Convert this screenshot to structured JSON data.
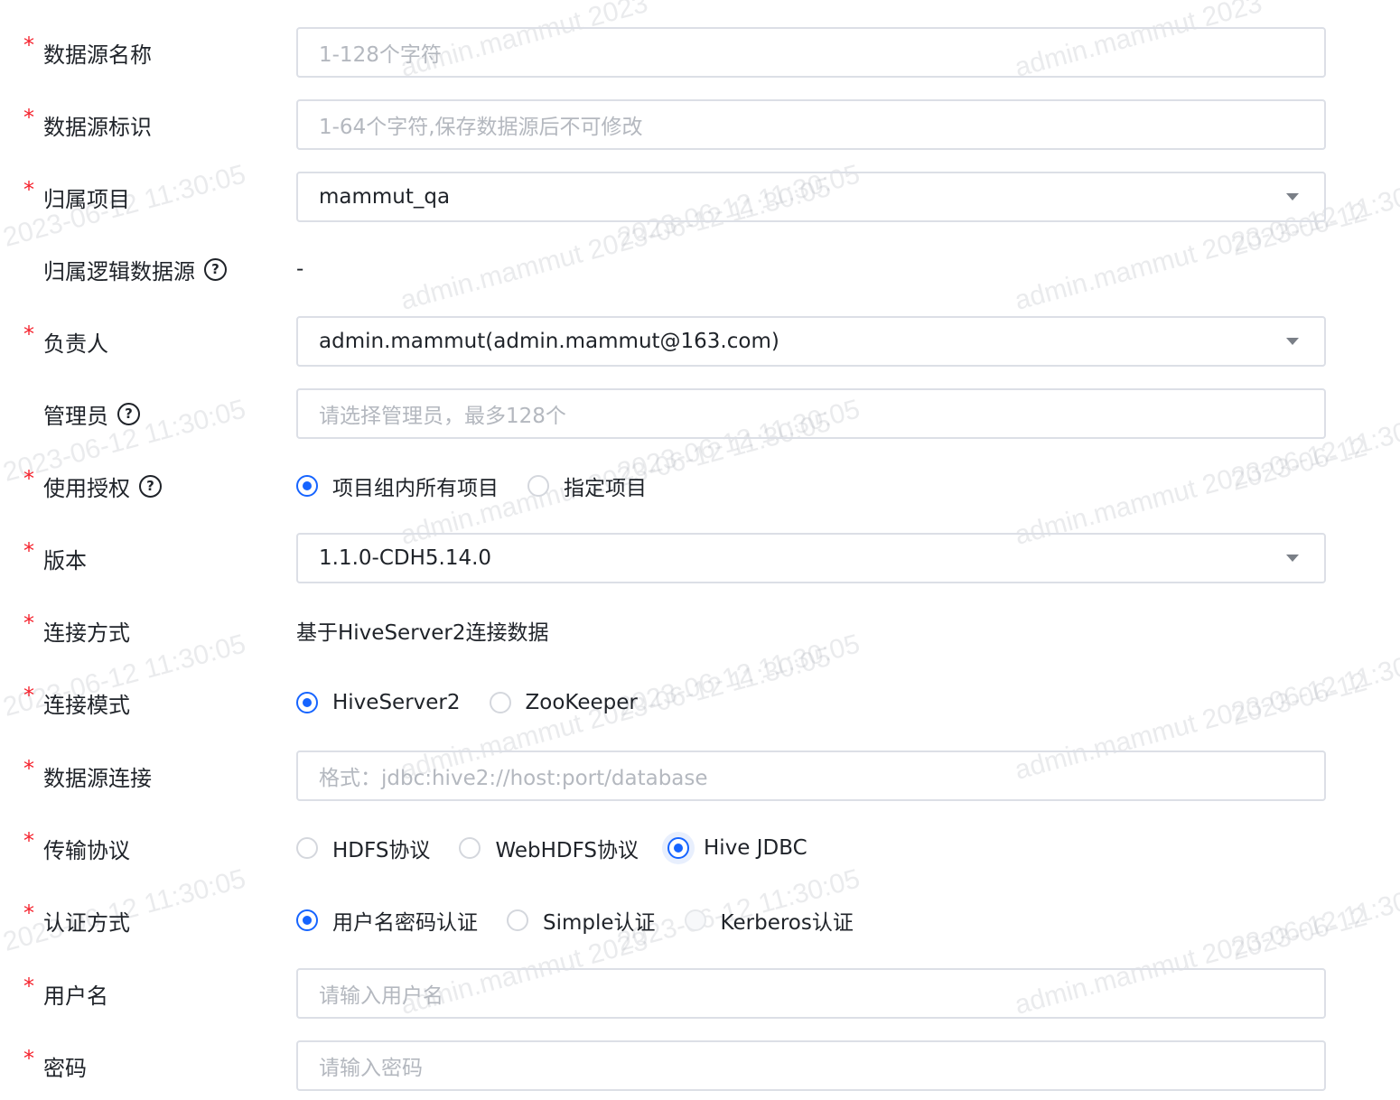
{
  "watermark": {
    "text_full": "admin.mammut 2023-06-12 11:30:05",
    "text_name": "admin.mammut 2023",
    "text_time": "2023-06-12 11:30:05",
    "text_date": "2023-06-12"
  },
  "fields": {
    "name": {
      "label": "数据源名称",
      "required": "*",
      "placeholder": "1-128个字符"
    },
    "identifier": {
      "label": "数据源标识",
      "required": "*",
      "placeholder": "1-64个字符,保存数据源后不可修改"
    },
    "project": {
      "label": "归属项目",
      "required": "*",
      "value": "mammut_qa"
    },
    "logical_source": {
      "label": "归属逻辑数据源",
      "value": "-"
    },
    "owner": {
      "label": "负责人",
      "required": "*",
      "value": "admin.mammut(admin.mammut@163.com)"
    },
    "admins": {
      "label": "管理员",
      "placeholder": "请选择管理员，最多128个"
    },
    "authorization": {
      "label": "使用授权",
      "required": "*",
      "options": [
        "项目组内所有项目",
        "指定项目"
      ],
      "selected": "项目组内所有项目"
    },
    "version": {
      "label": "版本",
      "required": "*",
      "value": "1.1.0-CDH5.14.0"
    },
    "connection_method": {
      "label": "连接方式",
      "required": "*",
      "value": "基于HiveServer2连接数据"
    },
    "connection_mode": {
      "label": "连接模式",
      "required": "*",
      "options": [
        "HiveServer2",
        "ZooKeeper"
      ],
      "selected": "HiveServer2"
    },
    "connection_url": {
      "label": "数据源连接",
      "required": "*",
      "placeholder": "格式：jdbc:hive2://host:port/database"
    },
    "protocol": {
      "label": "传输协议",
      "required": "*",
      "options": [
        "HDFS协议",
        "WebHDFS协议",
        "Hive JDBC"
      ],
      "selected": "Hive JDBC"
    },
    "auth_type": {
      "label": "认证方式",
      "required": "*",
      "options": [
        "用户名密码认证",
        "Simple认证",
        "Kerberos认证"
      ],
      "selected": "用户名密码认证",
      "disabled": "Kerberos认证"
    },
    "username": {
      "label": "用户名",
      "required": "*",
      "placeholder": "请输入用户名"
    },
    "password": {
      "label": "密码",
      "required": "*",
      "placeholder": "请输入密码"
    }
  },
  "icons": {
    "help": "question-circle-icon",
    "dropdown": "caret-down-icon"
  },
  "colors": {
    "required": "#f5222d",
    "primary": "#1664ff",
    "border": "#dcdfe6",
    "placeholder": "#b4b8bf"
  }
}
